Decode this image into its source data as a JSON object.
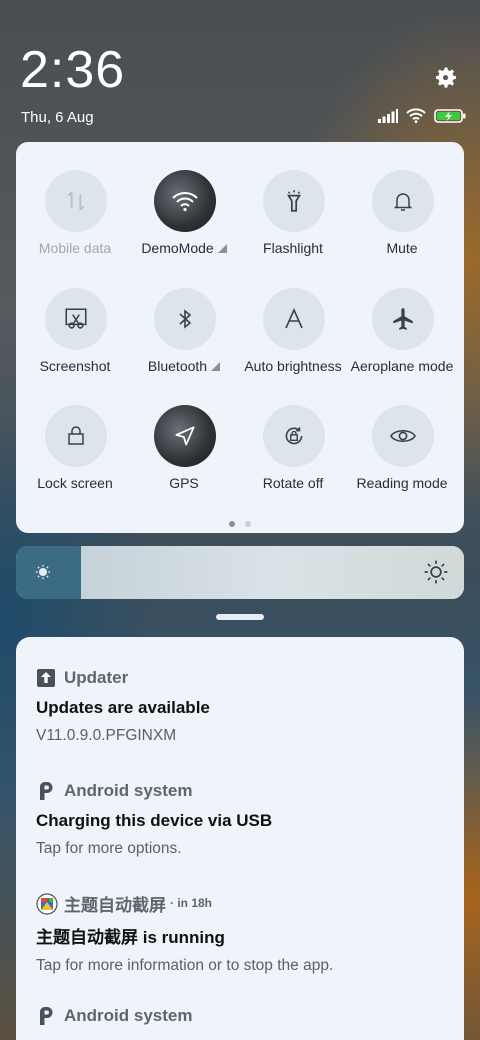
{
  "status_bar": {
    "time": "2:36",
    "date": "Thu, 6 Aug",
    "icons": [
      "signal-icon",
      "wifi-icon",
      "battery-charging-icon",
      "settings-gear-icon"
    ],
    "battery_color": "#3ec93e"
  },
  "quick_settings": {
    "tiles": [
      {
        "label": "Mobile data",
        "icon": "mobile-data-icon",
        "active": false,
        "disabled": true
      },
      {
        "label": "DemoMode",
        "icon": "wifi-icon",
        "active": true,
        "expand": true
      },
      {
        "label": "Flashlight",
        "icon": "flashlight-icon",
        "active": false
      },
      {
        "label": "Mute",
        "icon": "bell-icon",
        "active": false
      },
      {
        "label": "Screenshot",
        "icon": "screenshot-icon",
        "active": false
      },
      {
        "label": "Bluetooth",
        "icon": "bluetooth-icon",
        "active": false,
        "expand": true
      },
      {
        "label": "Auto brightness",
        "icon": "auto-brightness-icon",
        "active": false
      },
      {
        "label": "Aeroplane mode",
        "icon": "airplane-icon",
        "active": false
      },
      {
        "label": "Lock screen",
        "icon": "lock-icon",
        "active": false
      },
      {
        "label": "GPS",
        "icon": "location-arrow-icon",
        "active": true
      },
      {
        "label": "Rotate off",
        "icon": "rotation-lock-icon",
        "active": false
      },
      {
        "label": "Reading mode",
        "icon": "eye-icon",
        "active": false
      }
    ],
    "page_count": 2,
    "current_page": 1
  },
  "brightness": {
    "level": 0.145,
    "icons": [
      "brightness-low-icon",
      "brightness-high-icon"
    ],
    "fill_color": "#3c6b84"
  },
  "notifications": [
    {
      "app": "Updater",
      "icon": "updater-icon",
      "title": "Updates are available",
      "body": "V11.0.9.0.PFGINXM",
      "time": ""
    },
    {
      "app": "Android system",
      "icon": "android-system-icon",
      "title": "Charging this device via USB",
      "body": "Tap for more options.",
      "time": ""
    },
    {
      "app": "主题自动截屏",
      "icon": "theme-app-icon",
      "title": "主题自动截屏 is running",
      "body": "Tap for more information or to stop the app.",
      "time": "· in 18h"
    },
    {
      "app": "Android system",
      "icon": "android-system-icon",
      "title": "",
      "body": "",
      "time": ""
    }
  ]
}
